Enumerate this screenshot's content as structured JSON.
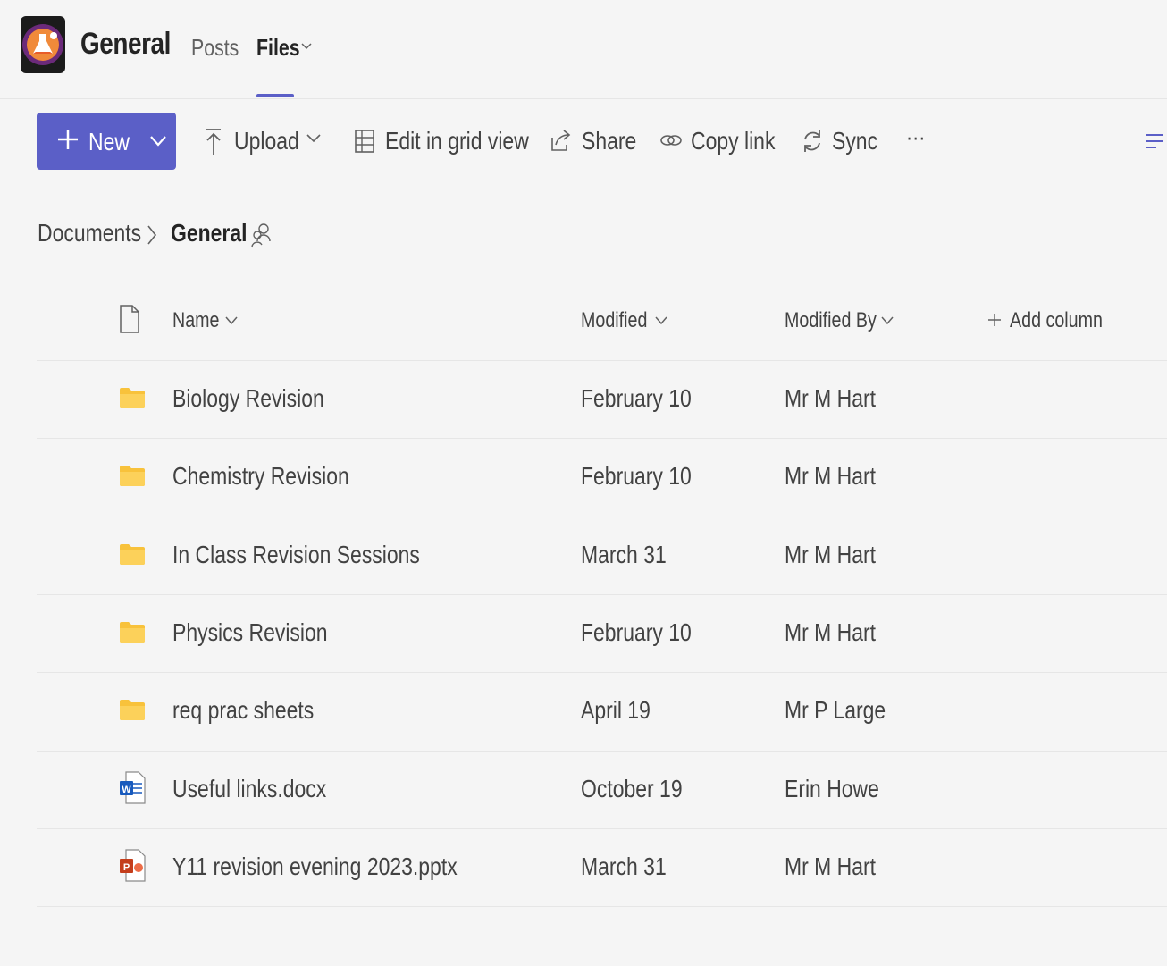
{
  "header": {
    "team_name": "General",
    "tabs": [
      {
        "label": "Posts",
        "active": false
      },
      {
        "label": "Files",
        "active": true
      }
    ]
  },
  "toolbar": {
    "new_label": "New",
    "upload_label": "Upload",
    "grid_label": "Edit in grid view",
    "share_label": "Share",
    "copy_link_label": "Copy link",
    "sync_label": "Sync",
    "more_label": "···"
  },
  "breadcrumb": {
    "root": "Documents",
    "current": "General"
  },
  "table": {
    "columns": {
      "name": "Name",
      "modified": "Modified",
      "modified_by": "Modified By",
      "add_column": "Add column"
    },
    "rows": [
      {
        "name": "Biology Revision",
        "modified": "February 10",
        "modified_by": "Mr M Hart",
        "type": "folder"
      },
      {
        "name": "Chemistry Revision",
        "modified": "February 10",
        "modified_by": "Mr M Hart",
        "type": "folder"
      },
      {
        "name": "In Class Revision Sessions",
        "modified": "March 31",
        "modified_by": "Mr M Hart",
        "type": "folder"
      },
      {
        "name": "Physics Revision",
        "modified": "February 10",
        "modified_by": "Mr M Hart",
        "type": "folder"
      },
      {
        "name": "req prac sheets",
        "modified": "April 19",
        "modified_by": "Mr P Large",
        "type": "folder"
      },
      {
        "name": "Useful links.docx",
        "modified": "October 19",
        "modified_by": "Erin Howe",
        "type": "word"
      },
      {
        "name": "Y11 revision evening 2023.pptx",
        "modified": "March 31",
        "modified_by": "Mr M Hart",
        "type": "powerpoint"
      }
    ]
  },
  "colors": {
    "accent": "#5b5fc7",
    "folder": "#f8c23b",
    "word": "#185abd",
    "powerpoint": "#c43e1c"
  }
}
